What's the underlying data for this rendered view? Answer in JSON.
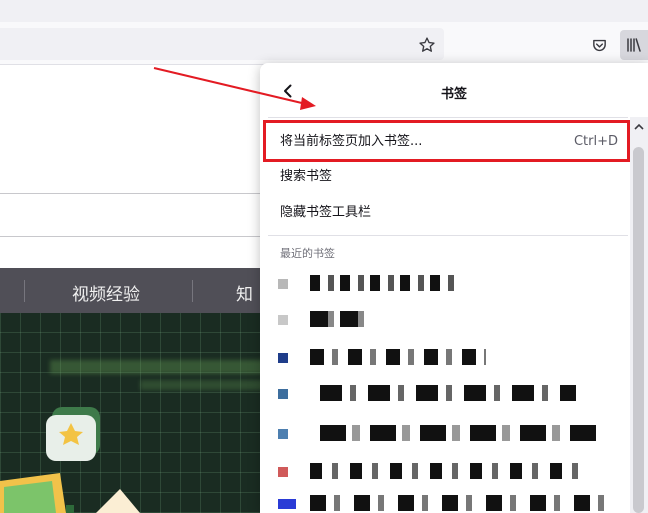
{
  "toolbar": {
    "star_icon": "star-outline-icon",
    "pocket_icon": "pocket-icon",
    "library_icon": "library-icon"
  },
  "site_nav": {
    "items": [
      "视频经验",
      "知"
    ]
  },
  "bookmarks_panel": {
    "title": "书签",
    "back_icon": "chevron-left-icon",
    "menu": [
      {
        "label": "将当前标签页加入书签...",
        "shortcut": "Ctrl+D"
      },
      {
        "label": "搜索书签",
        "shortcut": ""
      },
      {
        "label": "隐藏书签工具栏",
        "shortcut": ""
      }
    ],
    "recent_header": "最近的书签",
    "recent_items": [
      {
        "favicon_color": "#b8b8b8"
      },
      {
        "favicon_color": "#c8c8c8"
      },
      {
        "favicon_color": "#1f3d8a"
      },
      {
        "favicon_color": "#3d6e9e"
      },
      {
        "favicon_color": "#4d7fb0"
      },
      {
        "favicon_color": "#d05a5a"
      },
      {
        "favicon_color": "#2a3bd6"
      }
    ]
  },
  "colors": {
    "highlight": "#e31b23",
    "accent_arrow": "#e31b23",
    "search_accent": "#4e6ef2"
  }
}
